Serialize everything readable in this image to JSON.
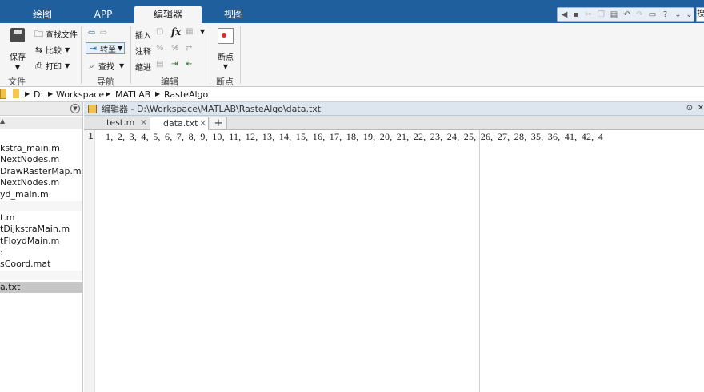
{
  "tabs": [
    {
      "label": "绘图"
    },
    {
      "label": "APP"
    },
    {
      "label": "编辑器"
    },
    {
      "label": "视图"
    }
  ],
  "search": {
    "partial_text": "搜"
  },
  "ribbon": {
    "file": {
      "save_label": "保存",
      "find_files_label": "查找文件",
      "compare_label": "比较",
      "print_label": "打印",
      "group_label": "文件"
    },
    "nav": {
      "goto_label": "转至",
      "find_label": "查找",
      "group_label": "导航"
    },
    "edit": {
      "insert_label": "插入",
      "comment_label": "注释",
      "indent_label": "缩进",
      "fx_label": "fx",
      "group_label": "编辑"
    },
    "breakpoints": {
      "breakpoints_label": "断点",
      "group_label": "断点"
    }
  },
  "address": {
    "drive": "D:",
    "segments": [
      "Workspace",
      "MATLAB",
      "RasteAlgo"
    ],
    "separator": "▶"
  },
  "file_list": [
    {
      "name": "kstra_main.m"
    },
    {
      "name": "NextNodes.m"
    },
    {
      "name": "DrawRasterMap.m"
    },
    {
      "name": "NextNodes.m"
    },
    {
      "name": "yd_main.m"
    },
    {
      "name": "t.m"
    },
    {
      "name": "tDijkstraMain.m"
    },
    {
      "name": "tFloydMain.m"
    },
    {
      "name": ":"
    },
    {
      "name": "sCoord.mat"
    },
    {
      "name": "a.txt"
    }
  ],
  "editor": {
    "title": "编辑器 - D:\\Workspace\\MATLAB\\RasteAlgo\\data.txt",
    "tabs": [
      {
        "label": "test.m"
      },
      {
        "label": "data.txt"
      }
    ],
    "line_number": "1",
    "line_text": "1,  2,  3,  4,  5,  6,  7,  8,  9,  10,  11,  12,  13,  14,  15,  16,  17,  18,  19,  20,  21,  22,  23,  24,  25,  26,  27,  28,  35,  36,  41,  42,  4"
  }
}
